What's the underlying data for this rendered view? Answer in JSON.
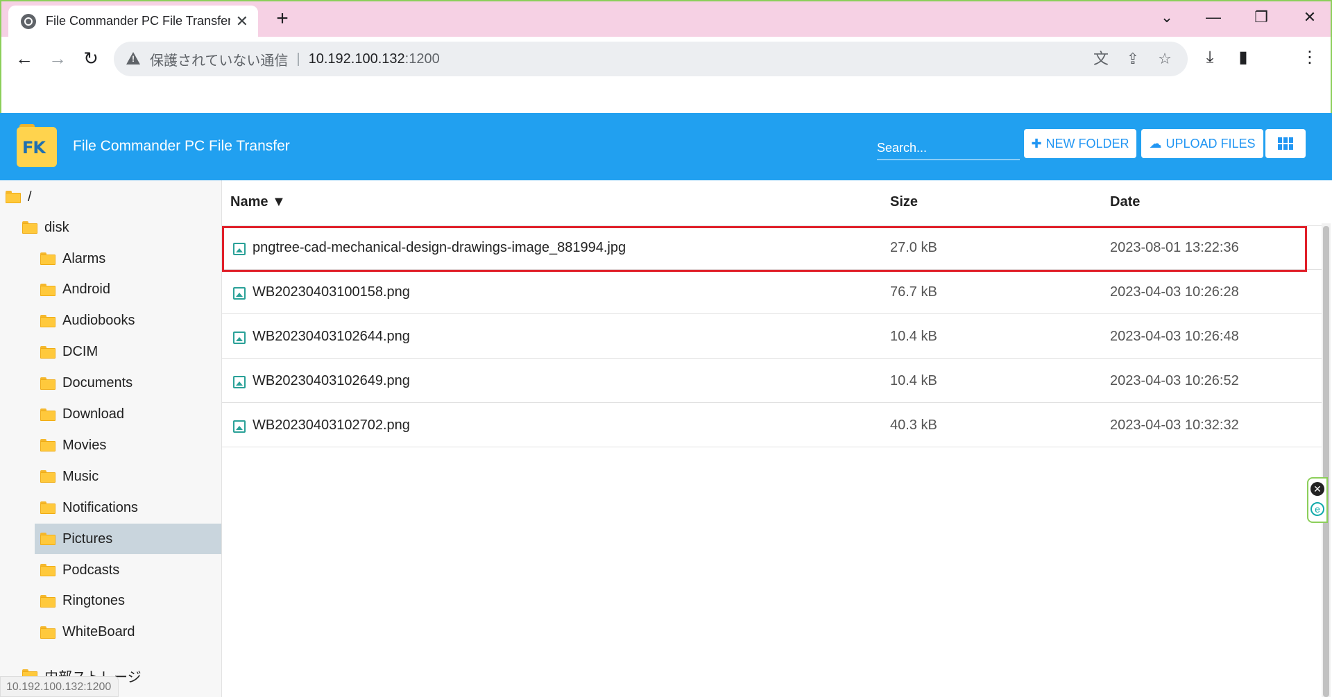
{
  "browser": {
    "tab_title": "File Commander PC File Transfer",
    "tab_close": "✕",
    "new_tab": "+",
    "controls": {
      "list": "⌄",
      "minimize": "—",
      "restore": "❐",
      "close": "✕"
    },
    "nav": {
      "back": "←",
      "forward": "→",
      "reload": "↻"
    },
    "address": {
      "security_text": "保護されていない通信",
      "separator": "|",
      "host": "10.192.100.132",
      "port": ":1200"
    },
    "omnibox_icons": [
      "translate-icon",
      "share-icon",
      "bookmark-star-icon"
    ],
    "right_icons": [
      "download-icon",
      "sidepanel-icon",
      "menu-icon"
    ],
    "status_url": "10.192.100.132:1200"
  },
  "app": {
    "logo_text": "FK",
    "title": "File Commander PC File Transfer",
    "search_placeholder": "Search...",
    "new_folder_label": "NEW FOLDER",
    "upload_files_label": "UPLOAD FILES",
    "view_toggle": "grid-view-icon",
    "accent_color": "#21a0f0"
  },
  "sidebar": {
    "root": "/",
    "disk": "disk",
    "folders": [
      "Alarms",
      "Android",
      "Audiobooks",
      "DCIM",
      "Documents",
      "Download",
      "Movies",
      "Music",
      "Notifications",
      "Pictures",
      "Podcasts",
      "Ringtones",
      "WhiteBoard"
    ],
    "selected": "Pictures",
    "internal_storage": "内部ストレージ"
  },
  "table": {
    "headers": {
      "name": "Name ▼",
      "size": "Size",
      "date": "Date"
    },
    "rows": [
      {
        "name": "pngtree-cad-mechanical-design-drawings-image_881994.jpg",
        "size": "27.0 kB",
        "date": "2023-08-01 13:22:36"
      },
      {
        "name": "WB20230403100158.png",
        "size": "76.7 kB",
        "date": "2023-04-03 10:26:28"
      },
      {
        "name": "WB20230403102644.png",
        "size": "10.4 kB",
        "date": "2023-04-03 10:26:48"
      },
      {
        "name": "WB20230403102649.png",
        "size": "10.4 kB",
        "date": "2023-04-03 10:26:52"
      },
      {
        "name": "WB20230403102702.png",
        "size": "40.3 kB",
        "date": "2023-04-03 10:32:32"
      }
    ],
    "highlight_color": "#e0202a"
  }
}
